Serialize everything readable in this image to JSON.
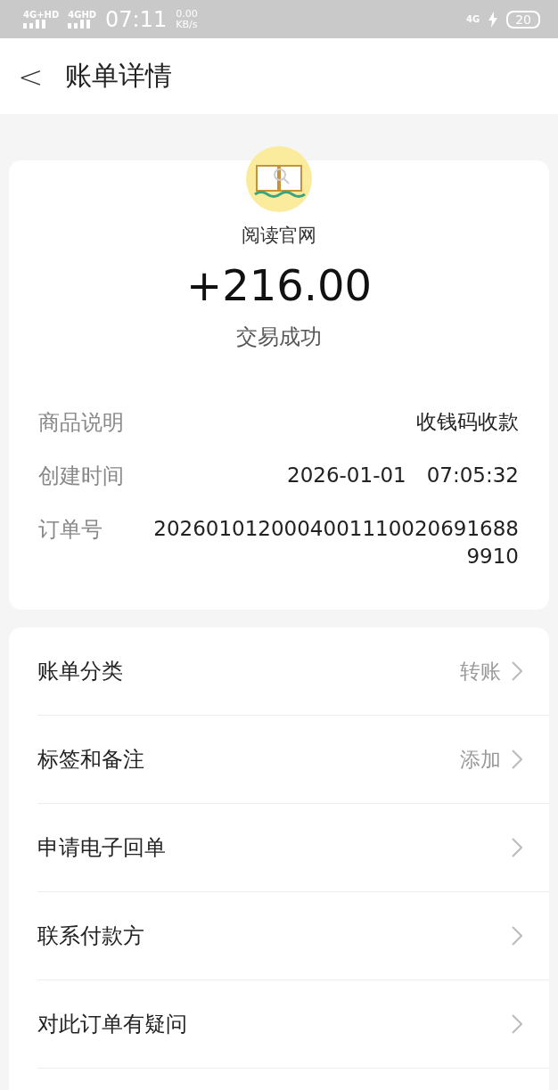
{
  "status_bar": {
    "network_1": "4G+HD",
    "network_2": "4GHD",
    "time": "07:11",
    "speed": "0.00",
    "speed_unit": "KB/s",
    "network_3": "4G",
    "battery": "20"
  },
  "header": {
    "back": "<",
    "title": "账单详情"
  },
  "summary": {
    "merchant": "阅读官网",
    "amount": "+216.00",
    "status": "交易成功"
  },
  "details": [
    {
      "label": "商品说明",
      "value": "收钱码收款"
    },
    {
      "label": "创建时间",
      "value": "2026-01-01　07:05:32"
    },
    {
      "label": "订单号",
      "value": "20260101200040011100206916889910"
    }
  ],
  "actions": [
    {
      "label": "账单分类",
      "value": "转账"
    },
    {
      "label": "标签和备注",
      "value": "添加"
    },
    {
      "label": "申请电子回单"
    },
    {
      "label": "联系付款方"
    },
    {
      "label": "对此订单有疑问"
    }
  ]
}
